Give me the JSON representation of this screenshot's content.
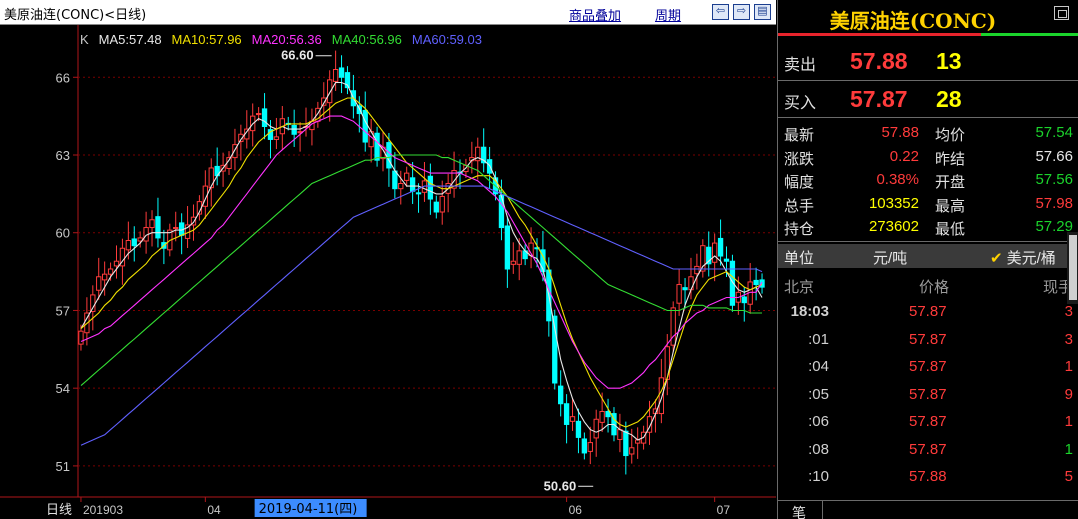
{
  "chart_title": "美原油连(CONC)<日线)",
  "toolbar": {
    "overlay": "商品叠加",
    "period": "周期"
  },
  "colors": {
    "up": "#ff3b3b",
    "down": "#00ffff",
    "ma5": "#e8e8e8",
    "ma10": "#f0e000",
    "ma20": "#ff33ff",
    "ma40": "#33dd33",
    "ma60": "#6060ff",
    "grid": "#7a0000",
    "axis": "#b0161a"
  },
  "indicator_legend": [
    {
      "text": "K",
      "color": "#c8c8c8"
    },
    {
      "text": "MA5:57.48",
      "color": "#e8e8e8"
    },
    {
      "text": "MA10:57.96",
      "color": "#f0e000"
    },
    {
      "text": "MA20:56.36",
      "color": "#ff33ff"
    },
    {
      "text": "MA40:56.96",
      "color": "#33dd33"
    },
    {
      "text": "MA60:59.03",
      "color": "#6060ff"
    }
  ],
  "chart_data": {
    "type": "candlestick",
    "period": "daily",
    "ylim": [
      49.8,
      67.4
    ],
    "yticks": [
      51,
      54,
      57,
      60,
      63,
      66
    ],
    "xtick_labels": [
      {
        "label": "201903",
        "i": 0
      },
      {
        "label": "04",
        "i": 21
      },
      {
        "label": "06",
        "i": 82
      },
      {
        "label": "07",
        "i": 107
      }
    ],
    "xlabel": "日线",
    "cursor_label": {
      "label": "2019-04-11(四)",
      "i": 30
    },
    "annotations": [
      {
        "text": "66.60",
        "i": 43,
        "value": 66.6,
        "side": "left"
      },
      {
        "text": "50.60",
        "i": 87,
        "value": 50.6,
        "side": "right"
      }
    ],
    "close": [
      56.2,
      56.9,
      57.6,
      58.3,
      58.4,
      58.6,
      58.9,
      59.4,
      59.7,
      59.5,
      59.8,
      60.2,
      60.5,
      59.8,
      59.4,
      60.1,
      60.2,
      59.9,
      60.3,
      60.6,
      61.2,
      61.8,
      62.5,
      62.2,
      62.6,
      62.9,
      63.4,
      63.8,
      64.0,
      64.5,
      64.6,
      64.1,
      63.6,
      63.7,
      64.4,
      64.2,
      63.8,
      63.9,
      64.1,
      64.3,
      64.8,
      65.2,
      65.9,
      66.3,
      66.0,
      65.6,
      64.9,
      64.6,
      63.5,
      63.9,
      62.8,
      63.3,
      62.5,
      61.7,
      61.9,
      62.3,
      61.6,
      61.5,
      62.0,
      61.3,
      60.8,
      61.4,
      61.9,
      62.4,
      62.3,
      62.6,
      62.9,
      63.3,
      62.7,
      62.3,
      61.5,
      60.2,
      58.6,
      58.9,
      59.3,
      59.0,
      59.6,
      59.4,
      58.5,
      56.6,
      54.2,
      53.4,
      52.6,
      52.9,
      52.1,
      51.5,
      51.9,
      52.8,
      53.1,
      52.9,
      52.2,
      52.4,
      51.4,
      51.7,
      52.0,
      52.3,
      52.9,
      53.2,
      54.4,
      55.6,
      57.1,
      58.0,
      57.8,
      58.3,
      58.7,
      59.5,
      58.8,
      59.6,
      59.1,
      58.9,
      57.2,
      57.7,
      57.3,
      58.1,
      58.0,
      57.9
    ],
    "ma5": [
      56.3,
      56.7,
      57.1,
      57.5,
      57.9,
      58.3,
      58.6,
      58.9,
      59.2,
      59.4,
      59.6,
      59.9,
      60.0,
      60.0,
      60.0,
      60.0,
      60.1,
      60.1,
      60.2,
      60.4,
      60.8,
      61.3,
      61.8,
      62.2,
      62.5,
      62.8,
      63.2,
      63.6,
      63.9,
      64.2,
      64.4,
      64.3,
      64.1,
      64.0,
      64.1,
      64.0,
      64.0,
      64.0,
      64.1,
      64.3,
      64.6,
      65.0,
      65.4,
      65.8,
      65.8,
      65.7,
      65.2,
      64.8,
      64.3,
      63.9,
      63.5,
      63.2,
      62.8,
      62.4,
      62.1,
      61.8,
      61.8,
      61.8,
      61.7,
      61.6,
      61.5,
      61.5,
      61.7,
      62.0,
      62.3,
      62.5,
      62.8,
      62.9,
      62.8,
      62.6,
      62.1,
      61.4,
      60.6,
      60.0,
      59.6,
      59.3,
      59.1,
      59.0,
      58.6,
      57.6,
      56.3,
      55.1,
      54.3,
      53.6,
      53.1,
      52.7,
      52.4,
      52.3,
      52.4,
      52.6,
      52.6,
      52.4,
      52.3,
      52.2,
      52.0,
      52.1,
      52.5,
      53.0,
      53.6,
      54.4,
      55.4,
      56.3,
      57.2,
      57.8,
      58.3,
      58.7,
      58.9,
      59.1,
      58.9,
      58.5,
      58.1,
      57.8,
      57.7,
      57.8,
      57.9,
      57.5
    ],
    "ma10": [
      56.3,
      56.5,
      56.7,
      56.9,
      57.2,
      57.4,
      57.7,
      57.9,
      58.2,
      58.4,
      58.6,
      58.8,
      59.1,
      59.3,
      59.5,
      59.7,
      59.8,
      59.9,
      60.0,
      60.1,
      60.3,
      60.6,
      60.9,
      61.2,
      61.5,
      61.8,
      62.2,
      62.5,
      62.9,
      63.2,
      63.5,
      63.7,
      63.9,
      64.0,
      64.1,
      64.2,
      64.2,
      64.2,
      64.2,
      64.3,
      64.4,
      64.6,
      64.8,
      65.0,
      65.1,
      65.2,
      65.2,
      65.0,
      64.8,
      64.5,
      64.2,
      63.9,
      63.6,
      63.3,
      63.0,
      62.7,
      62.5,
      62.3,
      62.1,
      61.9,
      61.8,
      61.7,
      61.7,
      61.8,
      61.9,
      62.0,
      62.1,
      62.2,
      62.2,
      62.2,
      62.0,
      61.7,
      61.4,
      61.0,
      60.6,
      60.3,
      59.9,
      59.5,
      59.1,
      58.6,
      57.9,
      57.2,
      56.5,
      55.9,
      55.4,
      54.9,
      54.4,
      54.0,
      53.6,
      53.2,
      52.8,
      52.6,
      52.5,
      52.6,
      52.7,
      52.9,
      53.2,
      53.5,
      53.9,
      54.4,
      55.1,
      55.8,
      56.5,
      57.1,
      57.6,
      57.9,
      58.2,
      58.3,
      58.4,
      58.5,
      58.3,
      58.1,
      57.9,
      57.8,
      57.9,
      58.0
    ],
    "ma20": [
      55.8,
      55.9,
      56.0,
      56.1,
      56.3,
      56.4,
      56.6,
      56.8,
      57.0,
      57.2,
      57.4,
      57.6,
      57.8,
      58.0,
      58.2,
      58.4,
      58.6,
      58.8,
      59.0,
      59.2,
      59.4,
      59.6,
      59.8,
      60.1,
      60.3,
      60.6,
      60.9,
      61.2,
      61.5,
      61.8,
      62.1,
      62.4,
      62.7,
      63.0,
      63.2,
      63.4,
      63.6,
      63.8,
      64.0,
      64.2,
      64.3,
      64.4,
      64.5,
      64.5,
      64.5,
      64.4,
      64.3,
      64.1,
      63.9,
      63.7,
      63.5,
      63.3,
      63.1,
      62.9,
      62.8,
      62.7,
      62.6,
      62.5,
      62.4,
      62.3,
      62.3,
      62.3,
      62.3,
      62.3,
      62.3,
      62.2,
      62.1,
      62.0,
      61.8,
      61.6,
      61.4,
      61.1,
      60.8,
      60.4,
      60.0,
      59.6,
      59.2,
      58.8,
      58.3,
      57.8,
      57.3,
      56.8,
      56.3,
      55.8,
      55.4,
      55.0,
      54.7,
      54.4,
      54.2,
      54.0,
      54.0,
      54.0,
      54.1,
      54.2,
      54.4,
      54.6,
      54.9,
      55.1,
      55.4,
      55.7,
      56.0,
      56.2,
      56.5,
      56.7,
      56.9,
      57.0,
      57.2,
      57.3,
      57.4,
      57.5,
      57.5,
      57.5,
      57.6,
      57.7,
      57.7,
      58.1
    ],
    "ma40": [
      54.1,
      54.3,
      54.5,
      54.7,
      54.9,
      55.1,
      55.3,
      55.5,
      55.7,
      55.9,
      56.1,
      56.3,
      56.5,
      56.7,
      56.9,
      57.1,
      57.3,
      57.5,
      57.7,
      57.9,
      58.1,
      58.3,
      58.5,
      58.7,
      58.9,
      59.1,
      59.3,
      59.5,
      59.7,
      59.9,
      60.1,
      60.3,
      60.5,
      60.7,
      60.9,
      61.1,
      61.3,
      61.5,
      61.7,
      61.9,
      62.0,
      62.1,
      62.2,
      62.3,
      62.4,
      62.5,
      62.6,
      62.7,
      62.8,
      62.8,
      62.9,
      62.9,
      62.9,
      63.0,
      63.0,
      63.0,
      63.0,
      63.0,
      63.0,
      63.0,
      63.0,
      62.9,
      62.9,
      62.8,
      62.7,
      62.6,
      62.5,
      62.4,
      62.2,
      62.0,
      61.8,
      61.6,
      61.4,
      61.2,
      61.0,
      60.8,
      60.6,
      60.4,
      60.2,
      60.0,
      59.8,
      59.6,
      59.4,
      59.2,
      59.0,
      58.8,
      58.6,
      58.4,
      58.2,
      58.0,
      57.9,
      57.8,
      57.7,
      57.6,
      57.5,
      57.4,
      57.3,
      57.2,
      57.1,
      57.0,
      57.0,
      57.0,
      57.1,
      57.2,
      57.2,
      57.2,
      57.1,
      57.1,
      57.1,
      57.1,
      57.0,
      57.0,
      57.0,
      56.9,
      56.9,
      56.9
    ],
    "ma60": [
      51.8,
      51.9,
      52.0,
      52.1,
      52.2,
      52.4,
      52.6,
      52.8,
      53.0,
      53.2,
      53.4,
      53.6,
      53.8,
      54.0,
      54.2,
      54.4,
      54.6,
      54.8,
      55.0,
      55.2,
      55.4,
      55.6,
      55.8,
      56.0,
      56.2,
      56.4,
      56.6,
      56.8,
      57.0,
      57.2,
      57.4,
      57.6,
      57.8,
      58.0,
      58.2,
      58.4,
      58.6,
      58.8,
      59.0,
      59.2,
      59.4,
      59.6,
      59.8,
      60.0,
      60.2,
      60.4,
      60.6,
      60.7,
      60.8,
      60.9,
      61.0,
      61.1,
      61.2,
      61.3,
      61.4,
      61.5,
      61.6,
      61.7,
      61.8,
      61.8,
      61.8,
      61.8,
      61.8,
      61.8,
      61.8,
      61.8,
      61.8,
      61.8,
      61.8,
      61.7,
      61.6,
      61.5,
      61.4,
      61.3,
      61.2,
      61.1,
      61.0,
      60.9,
      60.8,
      60.7,
      60.6,
      60.5,
      60.4,
      60.3,
      60.2,
      60.1,
      60.0,
      59.9,
      59.8,
      59.7,
      59.6,
      59.5,
      59.4,
      59.3,
      59.2,
      59.1,
      59.0,
      58.9,
      58.8,
      58.7,
      58.6,
      58.6,
      58.6,
      58.6,
      58.6,
      58.6,
      58.6,
      58.6,
      58.6,
      58.6,
      58.6,
      58.6,
      58.6,
      58.6,
      58.6,
      58.5
    ]
  },
  "quote": {
    "name": "美原油连(CONC)",
    "sell": {
      "label": "卖出",
      "price": "57.88",
      "volume": "13"
    },
    "buy": {
      "label": "买入",
      "price": "57.87",
      "volume": "28"
    },
    "stats": [
      {
        "l1": "最新",
        "v1": "57.88",
        "c1": "#ff3b3b",
        "l2": "均价",
        "v2": "57.54",
        "c2": "#1bd42c"
      },
      {
        "l1": "涨跌",
        "v1": "0.22",
        "c1": "#ff3b3b",
        "l2": "昨结",
        "v2": "57.66",
        "c2": "#e8e8e8"
      },
      {
        "l1": "幅度",
        "v1": "0.38%",
        "c1": "#ff3b3b",
        "l2": "开盘",
        "v2": "57.56",
        "c2": "#1bd42c"
      },
      {
        "l1": "总手",
        "v1": "103352",
        "c1": "#ffff00",
        "l2": "最高",
        "v2": "57.98",
        "c2": "#ff3b3b"
      },
      {
        "l1": "持仓",
        "v1": "273602",
        "c1": "#ffff00",
        "l2": "最低",
        "v2": "57.29",
        "c2": "#1bd42c"
      }
    ],
    "unit": {
      "label": "单位",
      "value": "元/吨",
      "alt": "美元/桶"
    },
    "ticks_header": {
      "location": "北京",
      "price": "价格",
      "volume": "现手"
    },
    "ticks": [
      {
        "time": "18:03",
        "price": "57.87",
        "vol": "3",
        "vcolor": "#ff3b3b"
      },
      {
        "time": ":01",
        "price": "57.87",
        "vol": "3",
        "vcolor": "#ff3b3b"
      },
      {
        "time": ":04",
        "price": "57.87",
        "vol": "1",
        "vcolor": "#ff3b3b"
      },
      {
        "time": ":05",
        "price": "57.87",
        "vol": "9",
        "vcolor": "#ff3b3b"
      },
      {
        "time": ":06",
        "price": "57.87",
        "vol": "1",
        "vcolor": "#ff3b3b"
      },
      {
        "time": ":08",
        "price": "57.87",
        "vol": "1",
        "vcolor": "#1bd42c"
      },
      {
        "time": ":10",
        "price": "57.88",
        "vol": "5",
        "vcolor": "#ff3b3b"
      }
    ],
    "bottom_tab": "笔"
  }
}
